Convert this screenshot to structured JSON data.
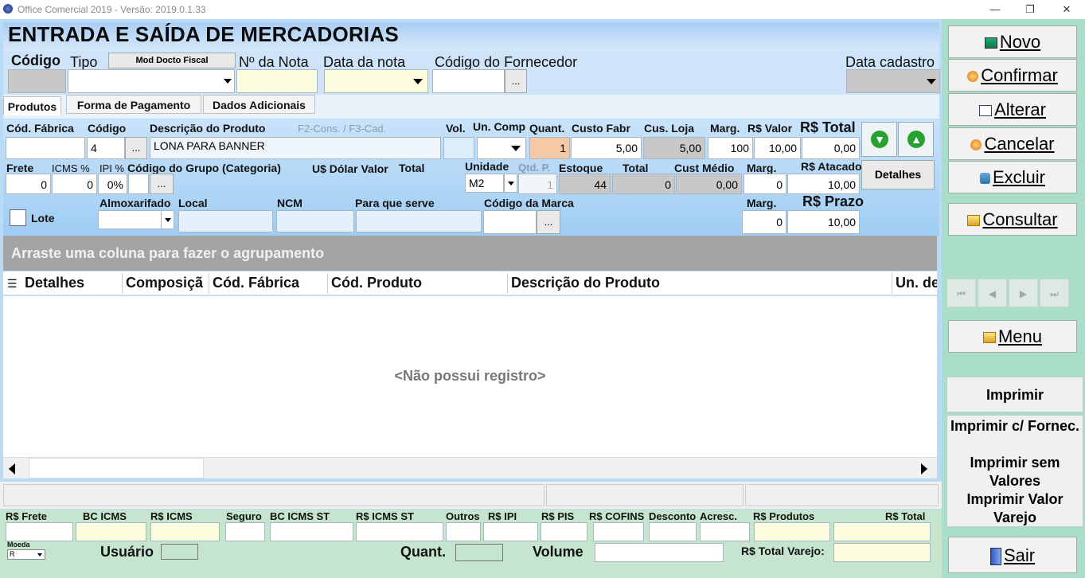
{
  "window": {
    "title": "Office Comercial 2019 - Versão: 2019.0.1.33",
    "minimize": "—",
    "restore": "❐",
    "close": "✕"
  },
  "page": {
    "title": "ENTRADA E SAÍDA DE MERCADORIAS"
  },
  "header": {
    "codigo_label": "Código",
    "tipo_label": "Tipo",
    "mod_docto_btn": "Mod Docto Fiscal",
    "nota_label": "Nº da Nota",
    "data_nota_label": "Data da nota",
    "fornecedor_label": "Código do Fornecedor",
    "cadastro_label": "Data cadastro",
    "ellipsis": "..."
  },
  "tabs": [
    "Produtos",
    "Forma de Pagamento",
    "Dados Adicionais"
  ],
  "produto": {
    "cod_fabrica_label": "Cód. Fábrica",
    "codigo_label": "Código",
    "codigo_value": "4",
    "descricao_label": "Descrição do Produto",
    "hint": "F2-Cons. / F3-Cad.",
    "descricao_value": "LONA PARA BANNER",
    "vol_label": "Vol.",
    "un_comp_label": "Un. Comp",
    "quant_label": "Quant.",
    "quant_value": "1",
    "custo_fabr_label": "Custo Fabr",
    "custo_fabr_value": "5,00",
    "cus_loja_label": "Cus. Loja",
    "cus_loja_value": "5,00",
    "marg_label": "Marg.",
    "marg_value": "100",
    "rs_valor_label": "R$ Valor",
    "rs_valor_value": "10,00",
    "rs_total_label": "R$ Total",
    "rs_total_value": "0,00",
    "frete_label": "Frete",
    "frete_value": "0",
    "icms_label": "ICMS %",
    "icms_value": "0",
    "ipi_label": "IPI %",
    "ipi_value": "0%",
    "grupo_label": "Código do Grupo (Categoria)",
    "dolar_label": "U$ Dólar Valor",
    "total_label": "Total",
    "unidade_label": "Unidade",
    "unidade_value": "M2",
    "qtd_p_label": "Qtd. P.",
    "qtd_p_value": "1",
    "estoque_label": "Estoque",
    "estoque_value": "44",
    "total2_label": "Total",
    "total2_value": "0",
    "cust_medio_label": "Cust Médio",
    "cust_medio_value": "0,00",
    "marg2_label": "Marg.",
    "marg2_value": "0",
    "atacado_label": "R$ Atacado",
    "atacado_value": "10,00",
    "detalhes_btn": "Detalhes",
    "lote_label": "Lote",
    "almox_label": "Almoxarifado",
    "local_label": "Local",
    "ncm_label": "NCM",
    "para_que_label": "Para que serve",
    "marca_label": "Código da Marca",
    "marg3_label": "Marg.",
    "marg3_value": "0",
    "prazo_label": "R$ Prazo",
    "prazo_value": "10,00"
  },
  "grid": {
    "group_hint": "Arraste uma coluna para fazer o agrupamento",
    "columns": [
      "Detalhes",
      "Composiçã",
      "Cód. Fábrica",
      "Cód. Produto",
      "Descrição do Produto",
      "Un. de"
    ],
    "empty": "<Não possui registro>"
  },
  "totals": {
    "labels": [
      "R$ Frete",
      "BC ICMS",
      "R$ ICMS",
      "Seguro",
      "BC ICMS ST",
      "R$ ICMS ST",
      "Outros",
      "R$ IPI",
      "R$ PIS",
      "R$ COFINS",
      "Desconto",
      "Acresc.",
      "R$ Produtos",
      "R$ Total"
    ],
    "moeda_label": "Moeda",
    "moeda_value": "R",
    "usuario_label": "Usuário",
    "quant_label": "Quant.",
    "volume_label": "Volume",
    "total_varejo_label": "R$ Total Varejo:"
  },
  "sidebar": {
    "novo": "Novo",
    "confirmar": "Confirmar",
    "alterar": "Alterar",
    "cancelar": "Cancelar",
    "excluir": "Excluir",
    "consultar": "Consultar",
    "menu": "Menu",
    "imprimir": "Imprimir",
    "imprimir_fornec": "Imprimir c/ Fornec.",
    "imprimir_sem": "Imprimir sem Valores",
    "imprimir_varejo": "Imprimir Valor Varejo",
    "sair": "Sair"
  },
  "colors": {
    "accent_blue": "#b9dcf6",
    "side_green": "#aadec8",
    "footer_green": "#c6e5cf"
  }
}
